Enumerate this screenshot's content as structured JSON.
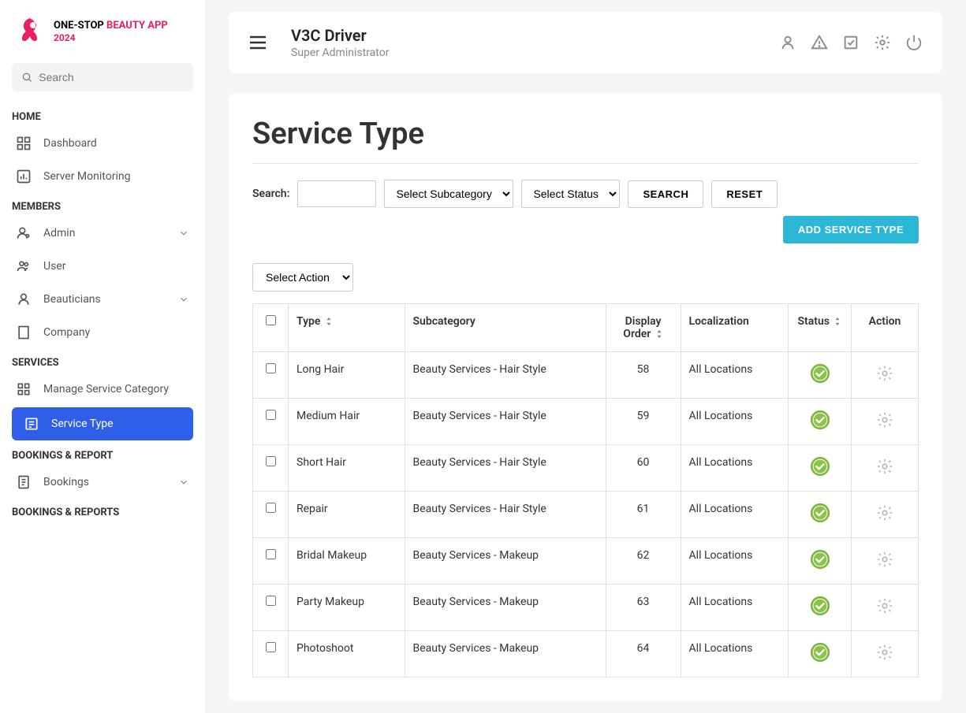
{
  "brand": {
    "line1_a": "ONE-STOP",
    "line1_b": "BEAUTY APP",
    "line2": "2024"
  },
  "search_placeholder": "Search",
  "nav": {
    "sections": {
      "home": "HOME",
      "members": "MEMBERS",
      "services": "SERVICES",
      "bookings_report": "BOOKINGS & REPORT",
      "bookings_reports": "BOOKINGS & REPORTS"
    },
    "items": {
      "dashboard": "Dashboard",
      "server_monitoring": "Server Monitoring",
      "admin": "Admin",
      "user": "User",
      "beauticians": "Beauticians",
      "company": "Company",
      "manage_service_category": "Manage Service Category",
      "service_type": "Service Type",
      "bookings": "Bookings"
    }
  },
  "topbar": {
    "user_name": "V3C Driver",
    "user_role": "Super Administrator"
  },
  "page": {
    "title": "Service Type",
    "search_label": "Search:",
    "subcategory_placeholder": "Select Subcategory",
    "status_placeholder": "Select Status",
    "search_btn": "SEARCH",
    "reset_btn": "RESET",
    "add_btn": "ADD SERVICE TYPE",
    "action_select_placeholder": "Select Action"
  },
  "table": {
    "headers": {
      "type": "Type",
      "subcategory": "Subcategory",
      "display_order_1": "Display",
      "display_order_2": "Order",
      "localization": "Localization",
      "status": "Status",
      "action": "Action"
    },
    "rows": [
      {
        "type": "Long Hair",
        "subcategory": "Beauty Services - Hair Style",
        "order": "58",
        "localization": "All Locations"
      },
      {
        "type": "Medium Hair",
        "subcategory": "Beauty Services - Hair Style",
        "order": "59",
        "localization": "All Locations"
      },
      {
        "type": "Short Hair",
        "subcategory": "Beauty Services - Hair Style",
        "order": "60",
        "localization": "All Locations"
      },
      {
        "type": "Repair",
        "subcategory": "Beauty Services - Hair Style",
        "order": "61",
        "localization": "All Locations"
      },
      {
        "type": "Bridal Makeup",
        "subcategory": "Beauty Services - Makeup",
        "order": "62",
        "localization": "All Locations"
      },
      {
        "type": "Party Makeup",
        "subcategory": "Beauty Services - Makeup",
        "order": "63",
        "localization": "All Locations"
      },
      {
        "type": "Photoshoot",
        "subcategory": "Beauty Services - Makeup",
        "order": "64",
        "localization": "All Locations"
      }
    ]
  }
}
